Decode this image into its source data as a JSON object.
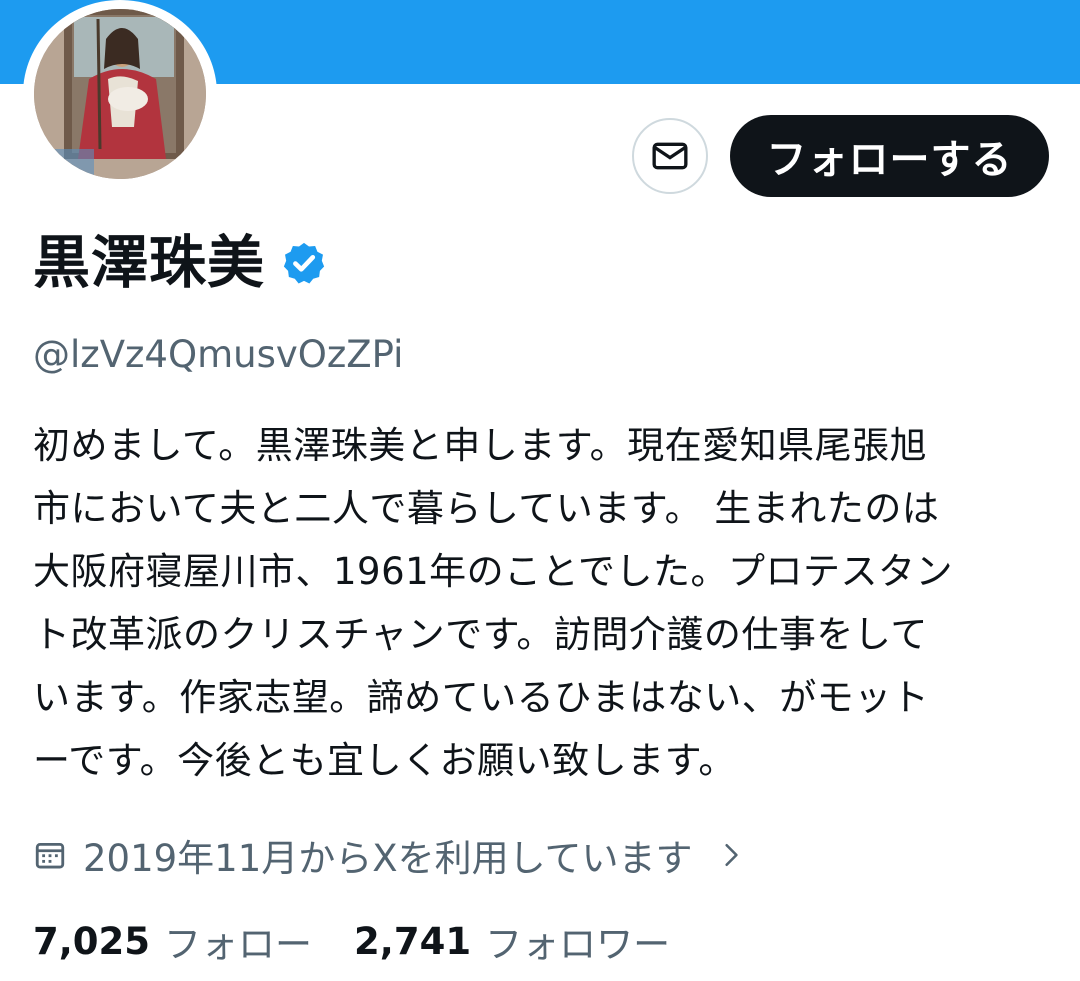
{
  "profile": {
    "display_name": "黒澤珠美",
    "handle": "@lzVz4QmusvOzZPi",
    "bio": "初めまして。黒澤珠美と申します。現在愛知県尾張旭\n市において夫と二人で暮らしています。 生まれたのは\n大阪府寝屋川市、1961年のことでした。プロテスタン\nト改革派のクリスチャンです。訪問介護の仕事をして\nいます。作家志望。諦めているひまはない、がモット\nーです。今後とも宜しくお願い致します。",
    "joined": "2019年11月からXを利用しています",
    "verified": true
  },
  "actions": {
    "follow_label": "フォローする",
    "message_icon": "mail-icon"
  },
  "stats": {
    "following_count": "7,025",
    "following_label": "フォロー",
    "followers_count": "2,741",
    "followers_label": "フォロワー"
  },
  "colors": {
    "banner": "#1d9bf0",
    "verified_badge": "#1d9bf0",
    "primary_text": "#0f1419",
    "secondary_text": "#536471",
    "follow_button_bg": "#0f1419"
  }
}
